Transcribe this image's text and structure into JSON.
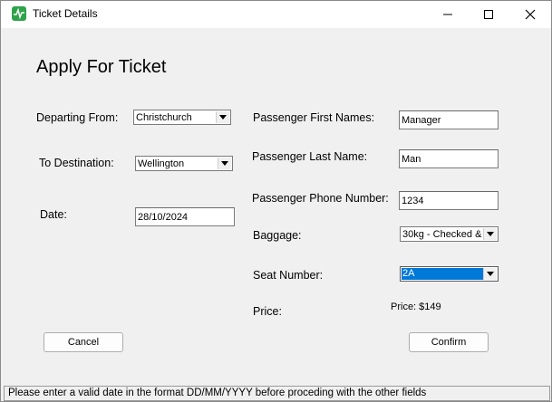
{
  "window": {
    "title": "Ticket Details"
  },
  "form": {
    "heading": "Apply For Ticket",
    "departing_label": "Departing From:",
    "departing_value": "Christchurch",
    "destination_label": "To Destination:",
    "destination_value": "Wellington",
    "date_label": "Date:",
    "date_value": "28/10/2024",
    "first_names_label": "Passenger First Names:",
    "first_names_value": "Manager",
    "last_name_label": "Passenger Last Name:",
    "last_name_value": "Man",
    "phone_label": "Passenger Phone Number:",
    "phone_value": "1234",
    "baggage_label": "Baggage:",
    "baggage_value": "30kg - Checked &",
    "seat_label": "Seat Number:",
    "seat_value": "2A",
    "price_label": "Price:",
    "price_value": "Price: $149"
  },
  "buttons": {
    "cancel": "Cancel",
    "confirm": "Confirm"
  },
  "status": {
    "message": "Please enter a valid date in the format DD/MM/YYYY before proceding with the other fields"
  },
  "colors": {
    "app_icon": "#2ea34a",
    "selection": "#0078d7"
  }
}
